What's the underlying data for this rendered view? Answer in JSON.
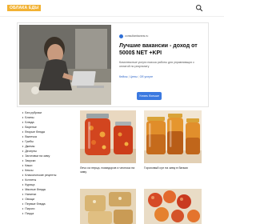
{
  "header": {
    "logo_text": "ОБЛАКА ЕДЫ",
    "search_icon": "search-icon"
  },
  "ad": {
    "domain": "consultantavans.ru",
    "title": "Лучшие вакансии - доход от 5000$ NET +KPI",
    "description": "Комплексные услуги поиска работы для управляющих с оплатой по результату",
    "links": [
      "Кейсы",
      "Цены",
      "Об услуге"
    ],
    "cta": "Узнать больше",
    "accent_color": "#3b79e0"
  },
  "menu": {
    "items": [
      "Без рубрики",
      "Блины",
      "Блюда",
      "Варенье",
      "Вторые блюда",
      "Выпечка",
      "Грибы",
      "Джемы",
      "Десерты",
      "Заготовки на зиму",
      "Закуски",
      "Каши",
      "Кексы",
      "Классические рецепты",
      "Котлеты",
      "Курица",
      "Мясные блюда",
      "Напитки",
      "Овощи",
      "Первые блюда",
      "Пироги",
      "Пицца"
    ]
  },
  "cards": [
    {
      "title": "Лечо из перца, помидоров и чеснока на зиму"
    },
    {
      "title": "Гороховый суп на зиму в банках"
    },
    {
      "title": ""
    },
    {
      "title": ""
    }
  ]
}
